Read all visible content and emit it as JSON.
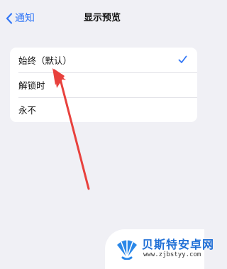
{
  "nav": {
    "back_label": "通知",
    "title": "显示预览"
  },
  "options": [
    {
      "label": "始终（默认）",
      "selected": true
    },
    {
      "label": "解锁时",
      "selected": false
    },
    {
      "label": "永不",
      "selected": false
    }
  ],
  "colors": {
    "accent": "#3478f6",
    "annotation": "#e8413d",
    "background": "#f0f0f5"
  },
  "icons": {
    "back": "chevron-left-icon",
    "selected": "checkmark-icon"
  },
  "watermark": {
    "name": "贝斯特安卓网",
    "url": "www.zjbstyy.com"
  }
}
